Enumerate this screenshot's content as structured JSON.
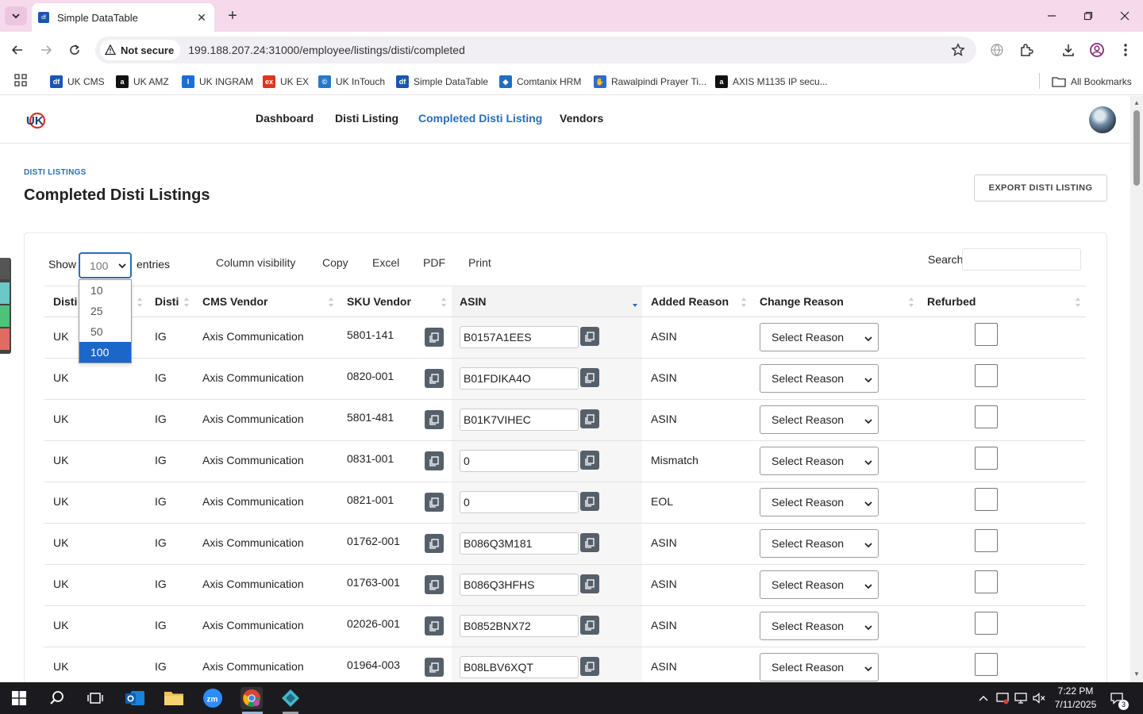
{
  "browser": {
    "tab_title": "Simple DataTable",
    "favicon_text": "df",
    "security_label": "Not secure",
    "url": "199.188.207.24:31000/employee/listings/disti/completed",
    "bookmarks": [
      {
        "label": "UK CMS",
        "icon": "uk-cms-favicon",
        "color": "#1a56b0",
        "glyph": "df"
      },
      {
        "label": "UK AMZ",
        "icon": "amazon-favicon",
        "color": "#111111",
        "glyph": "a"
      },
      {
        "label": "UK INGRAM",
        "icon": "ingram-favicon",
        "color": "#1a6fd6",
        "glyph": "I"
      },
      {
        "label": "UK EX",
        "icon": "ex-favicon",
        "color": "#e0361d",
        "glyph": "ex"
      },
      {
        "label": "UK InTouch",
        "icon": "intouch-favicon",
        "color": "#2877c8",
        "glyph": "©"
      },
      {
        "label": "Simple DataTable",
        "icon": "datatable-favicon",
        "color": "#1a56b0",
        "glyph": "df"
      },
      {
        "label": "Comtanix HRM",
        "icon": "comtanix-favicon",
        "color": "#1f6fc0",
        "glyph": "◆"
      },
      {
        "label": "Rawalpindi Prayer Ti...",
        "icon": "prayer-favicon",
        "color": "#2f6cc9",
        "glyph": "✋"
      },
      {
        "label": "AXIS M1135 IP secu...",
        "icon": "amazon-favicon",
        "color": "#111111",
        "glyph": "a"
      }
    ],
    "all_bookmarks": "All Bookmarks"
  },
  "header": {
    "nav": [
      "Dashboard",
      "Disti Listing",
      "Completed Disti Listing",
      "Vendors"
    ],
    "active": "Completed Disti Listing"
  },
  "page": {
    "breadcrumb": "DISTI LISTINGS",
    "title": "Completed Disti Listings",
    "export_button": "EXPORT DISTI LISTING"
  },
  "datatable": {
    "show_label": "Show",
    "entries_label": "entries",
    "page_length": "100",
    "length_options": [
      "10",
      "25",
      "50",
      "100"
    ],
    "buttons": [
      "Column visibility",
      "Copy",
      "Excel",
      "PDF",
      "Print"
    ],
    "search_label": "Search",
    "columns": [
      "Disti",
      "Disti",
      "CMS Vendor",
      "SKU Vendor",
      "ASIN",
      "Added Reason",
      "Change Reason",
      "Refurbed"
    ],
    "sorted_column": "ASIN",
    "select_placeholder": "Select Reason",
    "rows": [
      {
        "disti": "UK",
        "disti2": "IG",
        "vendor": "Axis Communication",
        "sku": "5801-141",
        "asin": "B0157A1EES",
        "reason": "ASIN"
      },
      {
        "disti": "UK",
        "disti2": "IG",
        "vendor": "Axis Communication",
        "sku": "0820-001",
        "asin": "B01FDIKA4O",
        "reason": "ASIN"
      },
      {
        "disti": "UK",
        "disti2": "IG",
        "vendor": "Axis Communication",
        "sku": "5801-481",
        "asin": "B01K7VIHEC",
        "reason": "ASIN"
      },
      {
        "disti": "UK",
        "disti2": "IG",
        "vendor": "Axis Communication",
        "sku": "0831-001",
        "asin": "0",
        "reason": "Mismatch"
      },
      {
        "disti": "UK",
        "disti2": "IG",
        "vendor": "Axis Communication",
        "sku": "0821-001",
        "asin": "0",
        "reason": "EOL"
      },
      {
        "disti": "UK",
        "disti2": "IG",
        "vendor": "Axis Communication",
        "sku": "01762-001",
        "asin": "B086Q3M181",
        "reason": "ASIN"
      },
      {
        "disti": "UK",
        "disti2": "IG",
        "vendor": "Axis Communication",
        "sku": "01763-001",
        "asin": "B086Q3HFHS",
        "reason": "ASIN"
      },
      {
        "disti": "UK",
        "disti2": "IG",
        "vendor": "Axis Communication",
        "sku": "02026-001",
        "asin": "B0852BNX72",
        "reason": "ASIN"
      },
      {
        "disti": "UK",
        "disti2": "IG",
        "vendor": "Axis Communication",
        "sku": "01964-003",
        "asin": "B08LBV6XQT",
        "reason": "ASIN"
      }
    ]
  },
  "taskbar": {
    "time": "7:22 PM",
    "date": "7/11/2025",
    "notifications": "3"
  },
  "colors": {
    "accent": "#2a6db8",
    "tabstrip": "#f7d9ec",
    "dropdown_selected": "#1a66c9",
    "copy_button": "#56606b",
    "taskbar": "#1b1b1f"
  }
}
